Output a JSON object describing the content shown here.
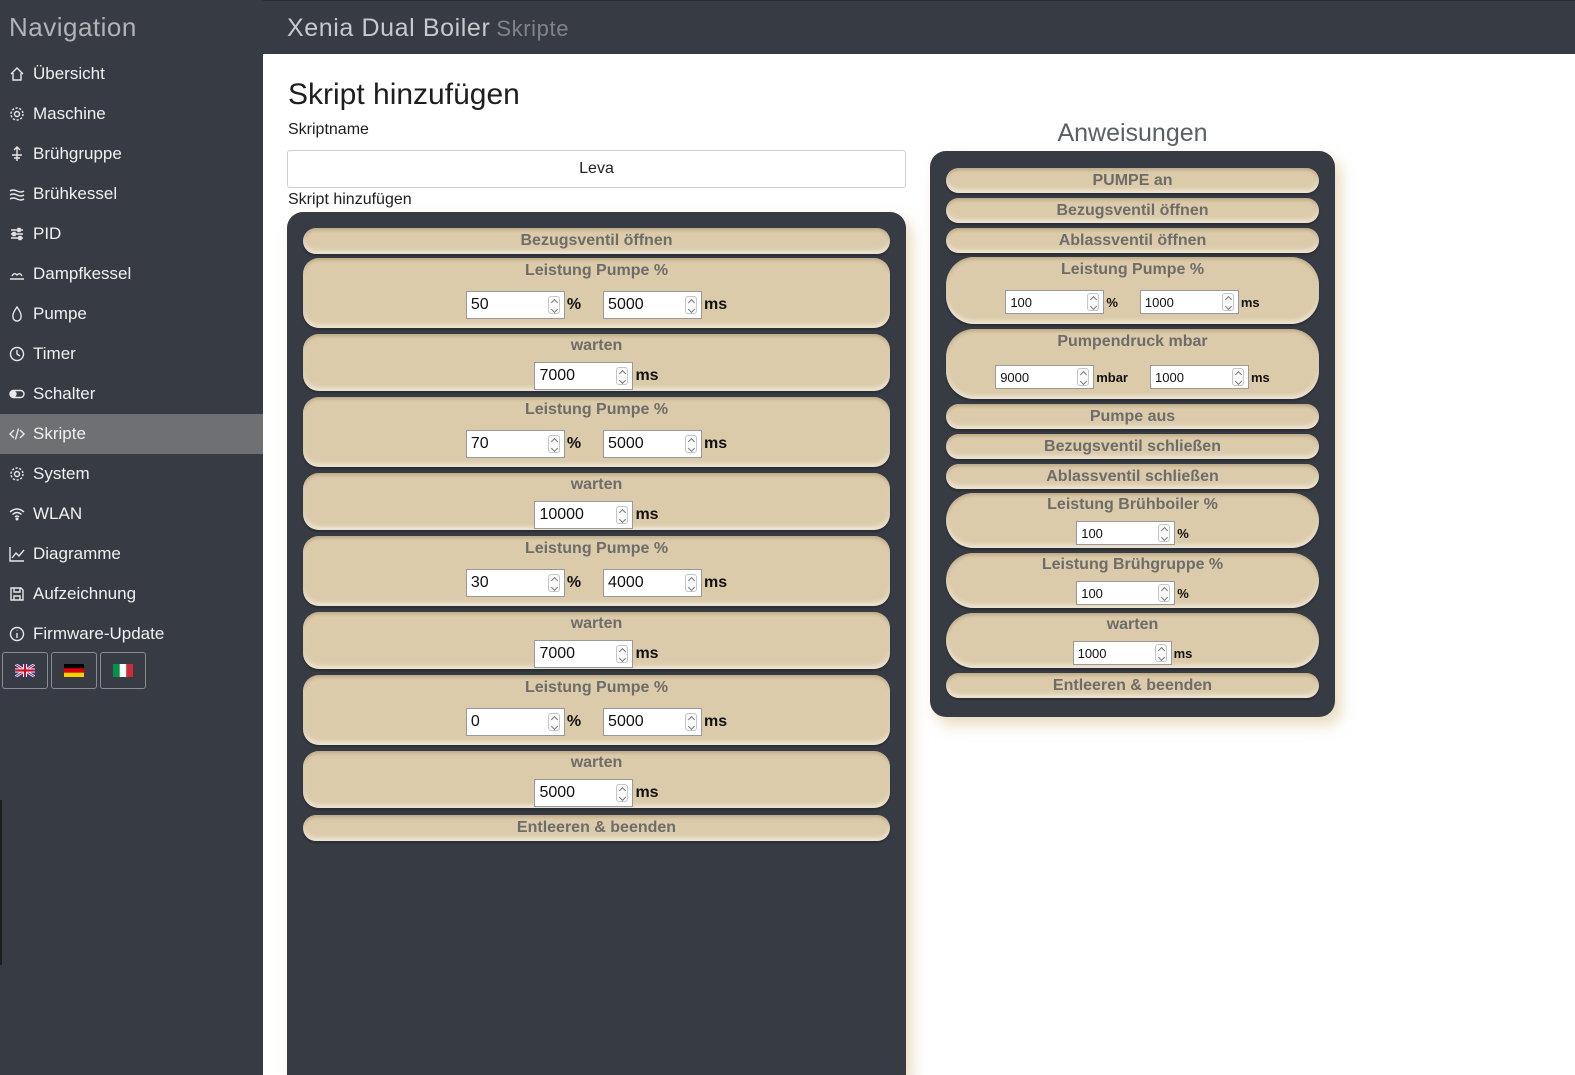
{
  "sidebar": {
    "title": "Navigation",
    "items": [
      {
        "label": "Übersicht",
        "icon": "home-icon"
      },
      {
        "label": "Maschine",
        "icon": "gear-icon"
      },
      {
        "label": "Brühgruppe",
        "icon": "brew-group-icon"
      },
      {
        "label": "Brühkessel",
        "icon": "waves-icon"
      },
      {
        "label": "PID",
        "icon": "sliders-icon"
      },
      {
        "label": "Dampfkessel",
        "icon": "steam-icon"
      },
      {
        "label": "Pumpe",
        "icon": "drop-icon"
      },
      {
        "label": "Timer",
        "icon": "clock-icon"
      },
      {
        "label": "Schalter",
        "icon": "toggle-icon"
      },
      {
        "label": "Skripte",
        "icon": "code-icon",
        "active": true
      },
      {
        "label": "System",
        "icon": "gear-icon"
      },
      {
        "label": "WLAN",
        "icon": "wifi-icon"
      },
      {
        "label": "Diagramme",
        "icon": "chart-icon"
      },
      {
        "label": "Aufzeichnung",
        "icon": "save-icon"
      },
      {
        "label": "Firmware-Update",
        "icon": "info-icon"
      }
    ],
    "languages": [
      "uk-flag-icon",
      "de-flag-icon",
      "it-flag-icon"
    ]
  },
  "header": {
    "title": "Xenia Dual Boiler",
    "subtitle": "Skripte"
  },
  "main": {
    "page_title": "Skript hinzufügen",
    "name_label": "Skriptname",
    "name_value": "Leva",
    "script_label": "Skript hinzufügen",
    "steps": [
      {
        "title": "Bezugsventil öffnen"
      },
      {
        "title": "Leistung Pumpe %",
        "v1": "50",
        "u1": "%",
        "v2": "5000",
        "u2": "ms"
      },
      {
        "title": "warten",
        "v1": "7000",
        "u1": "ms"
      },
      {
        "title": "Leistung Pumpe %",
        "v1": "70",
        "u1": "%",
        "v2": "5000",
        "u2": "ms"
      },
      {
        "title": "warten",
        "v1": "10000",
        "u1": "ms"
      },
      {
        "title": "Leistung Pumpe %",
        "v1": "30",
        "u1": "%",
        "v2": "4000",
        "u2": "ms"
      },
      {
        "title": "warten",
        "v1": "7000",
        "u1": "ms"
      },
      {
        "title": "Leistung Pumpe %",
        "v1": "0",
        "u1": "%",
        "v2": "5000",
        "u2": "ms"
      },
      {
        "title": "warten",
        "v1": "5000",
        "u1": "ms"
      },
      {
        "title": "Entleeren & beenden"
      }
    ]
  },
  "instructions": {
    "title": "Anweisungen",
    "items": [
      {
        "title": "PUMPE an"
      },
      {
        "title": "Bezugsventil öffnen"
      },
      {
        "title": "Ablassventil öffnen"
      },
      {
        "title": "Leistung Pumpe %",
        "v1": "100",
        "u1": "%",
        "v2": "1000",
        "u2": "ms"
      },
      {
        "title": "Pumpendruck mbar",
        "v1": "9000",
        "u1": "mbar",
        "v2": "1000",
        "u2": "ms"
      },
      {
        "title": "Pumpe aus"
      },
      {
        "title": "Bezugsventil schließen"
      },
      {
        "title": "Ablassventil schließen"
      },
      {
        "title": "Leistung Brühboiler %",
        "v1": "100",
        "u1": "%"
      },
      {
        "title": "Leistung Brühgruppe %",
        "v1": "100",
        "u1": "%"
      },
      {
        "title": "warten",
        "v1": "1000",
        "u1": "ms"
      },
      {
        "title": "Entleeren & beenden"
      }
    ]
  },
  "colors": {
    "sidebar_bg": "#373b43",
    "card_bg": "#dccbaa",
    "active_item": "#6f7073"
  }
}
